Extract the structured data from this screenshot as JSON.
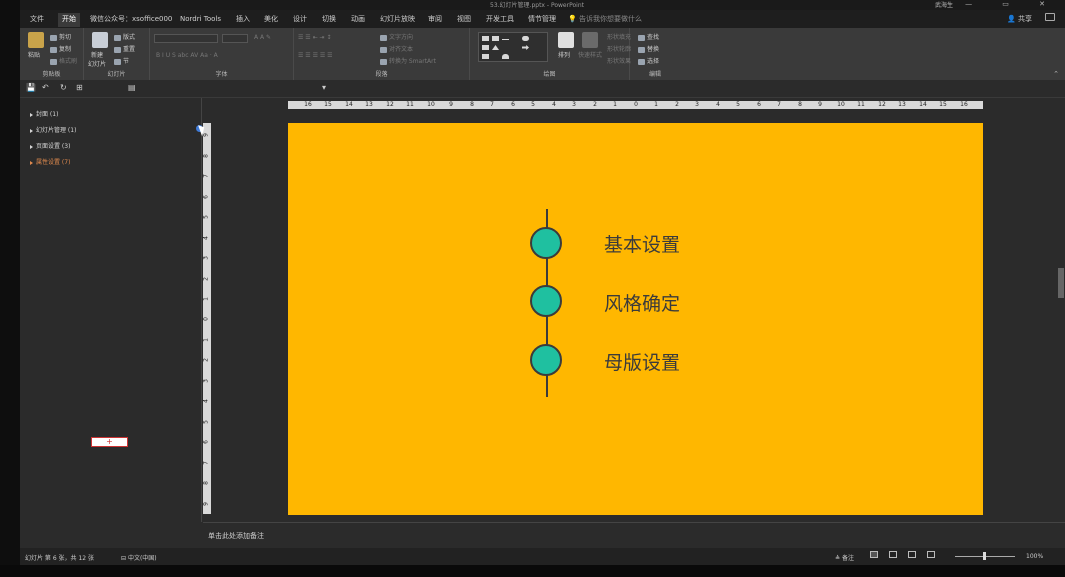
{
  "window": {
    "title": "53.幻灯片管理.pptx - PowerPoint",
    "user": "武海生",
    "controls": [
      "—",
      "▭",
      "✕"
    ]
  },
  "tabs": [
    "文件",
    "开始",
    "微信公众号：xsoffice000",
    "Nordri Tools",
    "插入",
    "美化",
    "设计",
    "切换",
    "动画",
    "幻灯片放映",
    "审阅",
    "视图",
    "开发工具",
    "情节管理"
  ],
  "active_tab": "开始",
  "tell_me": "告诉我你想要做什么",
  "share": "共享",
  "ribbon": {
    "clipboard": {
      "label": "剪贴板",
      "paste": "粘贴",
      "cut": "剪切",
      "copy": "复制",
      "format_painter": "格式刷"
    },
    "slides": {
      "label": "幻灯片",
      "new_slide": "新建\n幻灯片",
      "layout": "版式",
      "reset": "重置",
      "section": "节"
    },
    "font": {
      "label": "字体"
    },
    "paragraph": {
      "label": "段落",
      "text_direction": "文字方向",
      "align_text": "对齐文本",
      "convert_smartart": "转换为 SmartArt"
    },
    "drawing": {
      "label": "绘图",
      "arrange": "排列",
      "quick_styles": "快速样式",
      "shape_fill": "形状填充",
      "shape_outline": "形状轮廓",
      "shape_effects": "形状效果"
    },
    "editing": {
      "label": "编辑",
      "find": "查找",
      "replace": "替换",
      "select": "选择"
    }
  },
  "sections": [
    {
      "label": "封面 (1)",
      "active": false
    },
    {
      "label": "幻灯片管理 (1)",
      "active": false
    },
    {
      "label": "页面设置 (3)",
      "active": false
    },
    {
      "label": "属性设置 (7)",
      "active": true
    }
  ],
  "add_slide": "+",
  "slide": {
    "background": "#ffb700",
    "node_color": "#1fc0a0",
    "items": [
      "基本设置",
      "风格确定",
      "母版设置"
    ]
  },
  "hruler_ticks": [
    "16",
    "15",
    "14",
    "13",
    "12",
    "11",
    "10",
    "9",
    "8",
    "7",
    "6",
    "5",
    "4",
    "3",
    "2",
    "1",
    "0",
    "1",
    "2",
    "3",
    "4",
    "5",
    "6",
    "7",
    "8",
    "9",
    "10",
    "11",
    "12",
    "13",
    "14",
    "15",
    "16"
  ],
  "vruler_ticks": [
    "9",
    "8",
    "7",
    "6",
    "5",
    "4",
    "3",
    "2",
    "1",
    "0",
    "1",
    "2",
    "3",
    "4",
    "5",
    "6",
    "7",
    "8",
    "9"
  ],
  "notes_placeholder": "单击此处添加备注",
  "status": {
    "slide_info": "幻灯片 第 6 张，共 12 张",
    "language": "中文(中国)",
    "notes": "备注",
    "zoom": "100%"
  }
}
